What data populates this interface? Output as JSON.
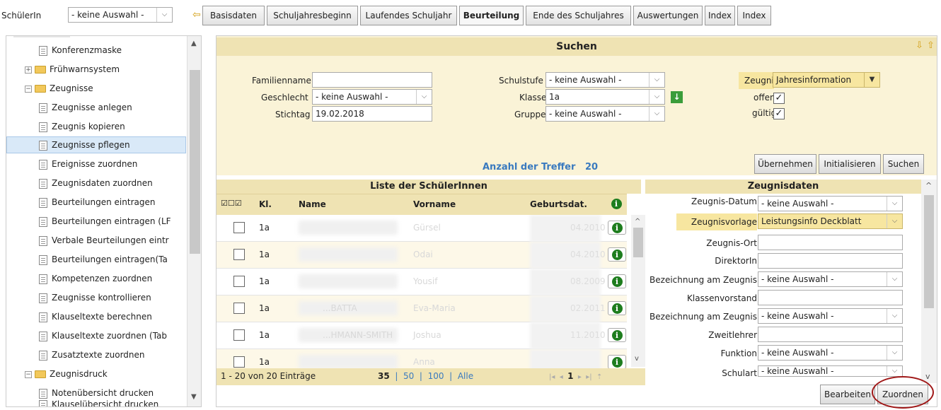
{
  "top": {
    "pupil_label": "SchülerIn",
    "pupil_select": "- keine Auswahl -"
  },
  "tabs": [
    "Basisdaten",
    "Schuljahresbeginn",
    "Laufendes Schuljahr",
    "Beurteilung",
    "Ende des Schuljahres",
    "Auswertungen",
    "Index",
    "Index"
  ],
  "tree": {
    "items": [
      "Konferenzmaske",
      "Frühwarnsystem",
      "Zeugnisse",
      "Zeugnisse anlegen",
      "Zeugnis kopieren",
      "Zeugnisse pflegen",
      "Ereignisse zuordnen",
      "Zeugnisdaten zuordnen",
      "Beurteilungen eintragen",
      "Beurteilungen eintragen (LF",
      "Verbale Beurteilungen eintr",
      "Beurteilungen eintragen(Ta",
      "Kompetenzen zuordnen",
      "Zeugnisse kontrollieren",
      "Klauseltexte berechnen",
      "Klauseltexte zuordnen (Tab",
      "Zusatztexte zuordnen",
      "Zeugnisdruck",
      "Notenübersicht drucken",
      "Klauselübersicht drucken"
    ]
  },
  "search": {
    "title": "Suchen",
    "familienname_label": "Familienname",
    "familienname_value": "",
    "geschlecht_label": "Geschlecht",
    "geschlecht_value": "- keine Auswahl -",
    "stichtag_label": "Stichtag",
    "stichtag_value": "19.02.2018",
    "schulstufe_label": "Schulstufe",
    "schulstufe_value": "- keine Auswahl -",
    "klasse_label": "Klasse",
    "klasse_value": "1a",
    "gruppe_label": "Gruppe",
    "gruppe_value": "- keine Auswahl -",
    "zeugnis_label": "Zeugnis.",
    "zeugnis_value": "Jahresinformation",
    "offen_label": "offen",
    "gueltig_label": "gültig",
    "hits_label": "Anzahl der Treffer",
    "hits_value": "20",
    "btn_uebernehmen": "Übernehmen",
    "btn_initialisieren": "Initialisieren",
    "btn_suchen": "Suchen"
  },
  "list": {
    "title": "Liste der SchülerInnen",
    "columns": [
      "Kl.",
      "Name",
      "Vorname",
      "Geburtsdat."
    ],
    "rows": [
      {
        "kl": "1a",
        "vorname": "Gürsel",
        "geb": "04.2010"
      },
      {
        "kl": "1a",
        "vorname": "Odai",
        "geb": "04.2010"
      },
      {
        "kl": "1a",
        "vorname": "Yousif",
        "geb": "08.2009"
      },
      {
        "kl": "1a",
        "name": "...BATTA",
        "vorname": "Eva-Maria",
        "geb": "02.2011"
      },
      {
        "kl": "1a",
        "name": "...HMANN-SMITH",
        "vorname": "Joshua",
        "geb": "11.2010"
      },
      {
        "kl": "1a",
        "vorname": "Anna",
        "geb": ""
      }
    ],
    "pager_info": "1 - 20 von 20 Einträge",
    "pager_sizes": [
      "35",
      "50",
      "100",
      "Alle"
    ],
    "page": "1"
  },
  "zeugnisdaten": {
    "title": "Zeugnisdaten",
    "fields": [
      {
        "label": "Zeugnis-Datum",
        "value": "- keine Auswahl -",
        "type": "select"
      },
      {
        "label": "Zeugnisvorlage",
        "value": "Leistungsinfo Deckblatt",
        "type": "select"
      },
      {
        "label": "Zeugnis-Ort",
        "value": "",
        "type": "input"
      },
      {
        "label": "DirektorIn",
        "value": "",
        "type": "input"
      },
      {
        "label": "Bezeichnung am Zeugnis",
        "value": "- keine Auswahl -",
        "type": "select"
      },
      {
        "label": "Klassenvorstand",
        "value": "",
        "type": "input"
      },
      {
        "label": "Bezeichnung am Zeugnis",
        "value": "- keine Auswahl -",
        "type": "select"
      },
      {
        "label": "Zweitlehrer",
        "value": "",
        "type": "input"
      },
      {
        "label": "Funktion",
        "value": "- keine Auswahl -",
        "type": "select"
      },
      {
        "label": "Schulart",
        "value": "- keine Auswahl -",
        "type": "select"
      }
    ],
    "btn_bearbeiten": "Bearbeiten",
    "btn_zuordnen": "Zuordnen"
  },
  "colors": {
    "search_bg": "#faf3d7",
    "header_bg": "#efe3b3",
    "highlight": "#f7e6a0",
    "selected": "#d9e9f8",
    "link": "#3a7abf",
    "info": "#1e7d1e",
    "circle": "#a01818"
  }
}
